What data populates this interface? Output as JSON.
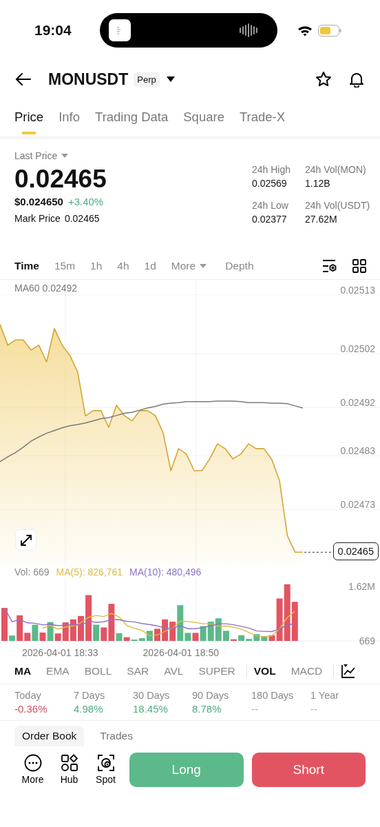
{
  "status_bar": {
    "time": "19:04"
  },
  "header": {
    "symbol": "MONUSDT",
    "badge": "Perp"
  },
  "tabs": [
    {
      "label": "Price",
      "selected": true
    },
    {
      "label": "Info",
      "selected": false
    },
    {
      "label": "Trading Data",
      "selected": false
    },
    {
      "label": "Square",
      "selected": false
    },
    {
      "label": "Trade-X",
      "selected": false
    }
  ],
  "ticker": {
    "last_price_label": "Last Price",
    "last_price": "0.02465",
    "usd_price": "$0.024650",
    "change": "+3.40%",
    "mark_price_label": "Mark Price",
    "mark_price": "0.02465",
    "stats": [
      {
        "label": "24h High",
        "value": "0.02569"
      },
      {
        "label": "24h Vol(MON)",
        "value": "1.12B"
      },
      {
        "label": "24h Low",
        "value": "0.02377"
      },
      {
        "label": "24h Vol(USDT)",
        "value": "27.62M"
      }
    ]
  },
  "intervals": [
    {
      "label": "Time",
      "selected": true,
      "kind": "option"
    },
    {
      "label": "15m",
      "selected": false,
      "kind": "option"
    },
    {
      "label": "1h",
      "selected": false,
      "kind": "option"
    },
    {
      "label": "4h",
      "selected": false,
      "kind": "option"
    },
    {
      "label": "1d",
      "selected": false,
      "kind": "option"
    },
    {
      "label": "More",
      "selected": false,
      "kind": "dropdown"
    },
    {
      "label": "Depth",
      "selected": false,
      "kind": "option"
    }
  ],
  "price_chart": {
    "legend_value": "0.02492",
    "current_price": "0.02465",
    "chart_data": {
      "type": "line",
      "grid": true,
      "ylim": [
        0.024626,
        0.025158
      ],
      "yticks": [
        0.02513,
        0.02502,
        0.02492,
        0.02483,
        0.02473
      ],
      "series": [
        {
          "type": "area",
          "color": "#d4a531",
          "values": [
            0.025075,
            0.025036,
            0.025046,
            0.025046,
            0.025027,
            0.025036,
            0.025005,
            0.025067,
            0.025036,
            0.025017,
            0.024986,
            0.024904,
            0.024914,
            0.024914,
            0.024883,
            0.024924,
            0.024905,
            0.024895,
            0.024914,
            0.024914,
            0.024905,
            0.024873,
            0.024802,
            0.024843,
            0.024833,
            0.024802,
            0.024802,
            0.024824,
            0.024852,
            0.024843,
            0.024824,
            0.024833,
            0.024852,
            0.024843,
            0.024843,
            0.024823,
            0.024783,
            0.024681,
            0.02465,
            0.02465
          ]
        },
        {
          "name": "MA60",
          "type": "line",
          "color": "#7a7a7a",
          "values": [
            0.024819,
            0.024828,
            0.024836,
            0.024846,
            0.024857,
            0.024865,
            0.024872,
            0.024877,
            0.024882,
            0.024886,
            0.024888,
            0.024891,
            0.024895,
            0.024899,
            0.024901,
            0.024905,
            0.024909,
            0.024911,
            0.024915,
            0.024919,
            0.024922,
            0.024926,
            0.024928,
            0.024929,
            0.024931,
            0.024931,
            0.024931,
            0.024931,
            0.024932,
            0.024932,
            0.024932,
            0.024931,
            0.024929,
            0.024929,
            0.024929,
            0.024928,
            0.024928,
            0.024927,
            0.024923,
            0.024919
          ]
        }
      ]
    }
  },
  "volume_chart": {
    "time_labels": [
      "2026-04-01 18:33",
      "2026-04-01 18:50"
    ],
    "legend": [
      {
        "text": "Vol: 669",
        "color": "#8a8a8a"
      },
      {
        "text": "MA(5): 826,761",
        "color": "#e2b93f"
      },
      {
        "text": "MA(10): 480,496",
        "color": "#8d73c6"
      }
    ],
    "chart_data": {
      "type": "bar",
      "stacked": true,
      "categories": [
        null,
        null,
        null,
        null,
        null,
        null,
        null,
        null,
        null,
        null,
        null,
        null,
        null,
        null,
        null,
        null,
        null,
        null,
        null,
        null,
        null,
        null,
        null,
        null,
        null,
        null,
        null,
        null,
        null,
        null,
        null,
        null,
        null,
        null,
        null,
        null,
        null,
        null,
        null
      ],
      "ylim": [
        0,
        1840000
      ],
      "yticks": [
        {
          "value": 669,
          "label": "669"
        },
        {
          "value": 1620000,
          "label": "1.62M"
        }
      ],
      "series": [
        {
          "color": "#e35462",
          "values": [
            980000,
            0,
            760000,
            240000,
            0,
            250000,
            0,
            220000,
            550000,
            640000,
            740000,
            1360000,
            0,
            400000,
            1100000,
            0,
            110000,
            0,
            0,
            0,
            360000,
            640000,
            570000,
            0,
            0,
            240000,
            0,
            0,
            0,
            0,
            50000,
            0,
            0,
            0,
            0,
            170000,
            1260000,
            1680000,
            1160000
          ]
        },
        {
          "color": "#5cb98a",
          "values": [
            0,
            160000,
            0,
            0,
            480000,
            0,
            560000,
            0,
            0,
            0,
            0,
            0,
            480000,
            0,
            0,
            230000,
            0,
            40000,
            80000,
            300000,
            0,
            0,
            0,
            1060000,
            240000,
            0,
            440000,
            570000,
            670000,
            300000,
            0,
            170000,
            60000,
            200000,
            140000,
            0,
            0,
            0,
            0
          ]
        },
        {
          "type": "line",
          "color": "#e2b93f",
          "values": [
            null,
            null,
            null,
            null,
            null,
            378000,
            458000,
            350000,
            412000,
            444000,
            542000,
            702000,
            754000,
            724000,
            816000,
            714000,
            464000,
            376000,
            312000,
            152000,
            178000,
            284000,
            390000,
            586000,
            574000,
            550000,
            510000,
            510000,
            432000,
            444000,
            406000,
            352000,
            250000,
            156000,
            124000,
            148000,
            366000,
            690000,
            882000
          ]
        },
        {
          "type": "line",
          "color": "#8d73c6",
          "values": [
            980000,
            570000,
            633000,
            535000,
            524000,
            478000,
            490000,
            456000,
            467000,
            484000,
            460000,
            580000,
            552000,
            568000,
            630000,
            628000,
            583000,
            565000,
            518000,
            484000,
            446000,
            374000,
            383000,
            449000,
            363000,
            364000,
            397000,
            450000,
            509000,
            509000,
            478000,
            431000,
            380000,
            294000,
            284000,
            277000,
            359000,
            470000,
            519000
          ]
        }
      ]
    }
  },
  "main_indicators": [
    {
      "label": "MA",
      "selected": true
    },
    {
      "label": "EMA",
      "selected": false
    },
    {
      "label": "BOLL",
      "selected": false
    },
    {
      "label": "SAR",
      "selected": false
    },
    {
      "label": "AVL",
      "selected": false
    },
    {
      "label": "SUPER",
      "selected": false
    }
  ],
  "sub_indicators": [
    {
      "label": "VOL",
      "selected": true
    },
    {
      "label": "MACD",
      "selected": false
    }
  ],
  "performance": [
    {
      "label": "Today",
      "value": "-0.36%",
      "color": "#d24f62"
    },
    {
      "label": "7 Days",
      "value": "4.98%",
      "color": "#4fae80"
    },
    {
      "label": "30 Days",
      "value": "18.45%",
      "color": "#4fae80"
    },
    {
      "label": "90 Days",
      "value": "8.78%",
      "color": "#4fae80"
    },
    {
      "label": "180 Days",
      "value": "--",
      "color": "#aaaaaa"
    },
    {
      "label": "1 Year",
      "value": "--",
      "color": "#aaaaaa"
    }
  ],
  "book_tabs": [
    {
      "label": "Order Book",
      "selected": true
    },
    {
      "label": "Trades",
      "selected": false
    }
  ],
  "bottom_bar": {
    "shortcuts": [
      {
        "label": "More"
      },
      {
        "label": "Hub"
      },
      {
        "label": "Spot"
      }
    ],
    "buttons": [
      {
        "label": "Long",
        "kind": "buy"
      },
      {
        "label": "Short",
        "kind": "sell"
      }
    ]
  }
}
